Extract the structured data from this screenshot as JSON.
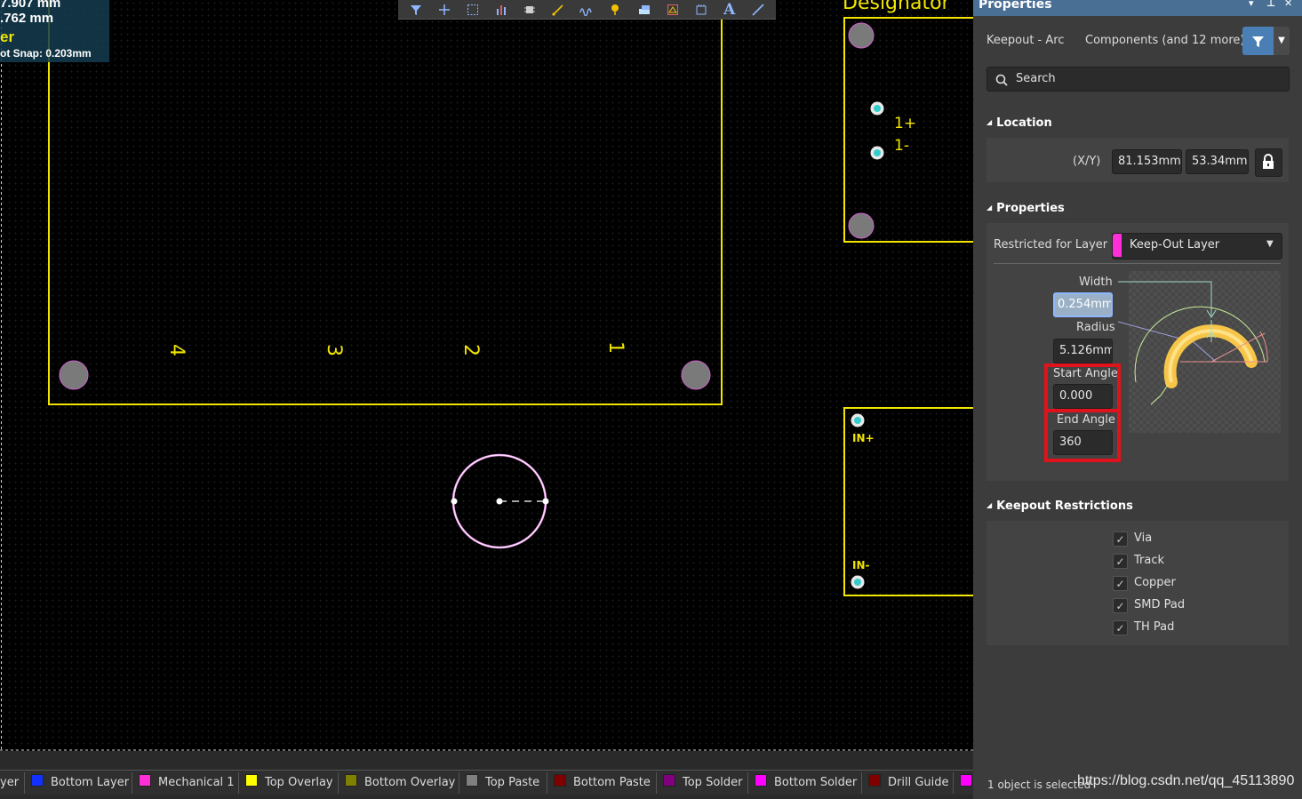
{
  "hud": {
    "line1": "7.907 mm",
    "line2": ".762  mm",
    "line3": "er",
    "line4": "ot Snap: 0.203mm"
  },
  "canvas": {
    "designator_label": "Designator",
    "pin_labels": [
      "4",
      "3",
      "2",
      "1"
    ],
    "conn_top_labels": [
      "1+",
      "1-"
    ],
    "conn_bottom_labels": [
      "IN+",
      "IN-"
    ],
    "colors": {
      "silkscreen": "#f2e600",
      "keepout": "#f0a0f0",
      "pad": "#7a7a7a",
      "via": "#33cccc"
    }
  },
  "toolbar": {
    "icons": [
      "filter-icon",
      "cross-icon",
      "select-rect-icon",
      "bar-chart-icon",
      "chip-icon",
      "route-icon",
      "interactive-length-icon",
      "pin-icon",
      "layer-stack-icon",
      "polygon-icon",
      "component-icon",
      "text-icon",
      "line-icon"
    ]
  },
  "panel": {
    "title": "Properties",
    "object_type": "Keepout - Arc",
    "filter_scope": "Components (and 12 more)",
    "search_placeholder": "Search",
    "location": {
      "header": "Location",
      "xy_label": "(X/Y)",
      "x": "81.153mm",
      "y": "53.34mm"
    },
    "properties": {
      "header": "Properties",
      "layer_label": "Restricted for Layer",
      "layer_value": "Keep-Out Layer",
      "layer_color": "#ff2fd8",
      "width_label": "Width",
      "width_value": "0.254mm",
      "radius_label": "Radius",
      "radius_value": "5.126mm",
      "start_angle_label": "Start Angle",
      "start_angle_value": "0.000",
      "end_angle_label": "End Angle",
      "end_angle_value": "360"
    },
    "restrictions": {
      "header": "Keepout Restrictions",
      "items": [
        {
          "label": "Via",
          "checked": true
        },
        {
          "label": "Track",
          "checked": true
        },
        {
          "label": "Copper",
          "checked": true
        },
        {
          "label": "SMD Pad",
          "checked": true
        },
        {
          "label": "TH Pad",
          "checked": true
        }
      ]
    },
    "status": "1 object is selected"
  },
  "layers": [
    {
      "name": "yer",
      "color": ""
    },
    {
      "name": "Bottom Layer",
      "color": "#1230ff"
    },
    {
      "name": "Mechanical 1",
      "color": "#ff2fd8"
    },
    {
      "name": "Top Overlay",
      "color": "#ffff00"
    },
    {
      "name": "Bottom Overlay",
      "color": "#808000"
    },
    {
      "name": "Top Paste",
      "color": "#808080"
    },
    {
      "name": "Bottom Paste",
      "color": "#800000"
    },
    {
      "name": "Top Solder",
      "color": "#800080"
    },
    {
      "name": "Bottom Solder",
      "color": "#ff00ff"
    },
    {
      "name": "Drill Guide",
      "color": "#800000"
    },
    {
      "name": "",
      "color": "#ff00ff"
    }
  ],
  "watermark": "https://blog.csdn.net/qq_45113890"
}
